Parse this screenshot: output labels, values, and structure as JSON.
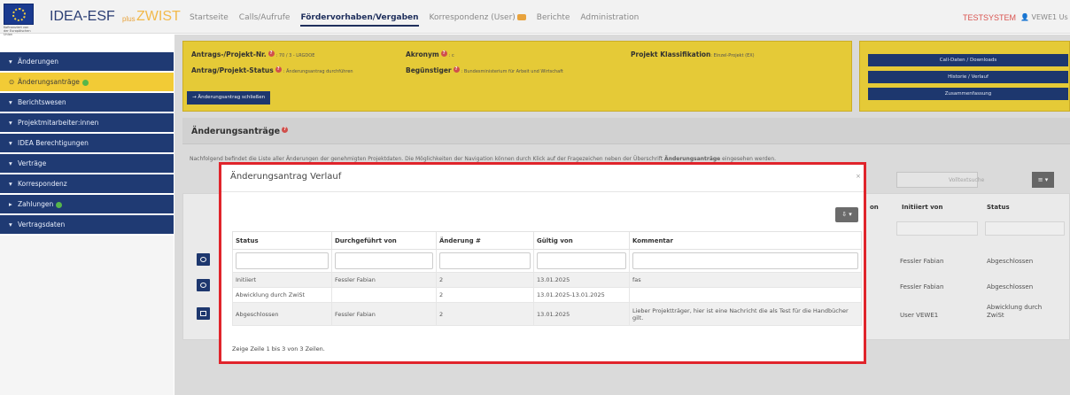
{
  "brand": {
    "eu_caption": "Kofinanziert von der Europäischen Union",
    "idea": "IDEA-ESF",
    "plus": "plus",
    "zwist": "ZWIST"
  },
  "nav": {
    "items": [
      "Startseite",
      "Calls/Aufrufe",
      "Fördervorhaben/Vergaben",
      "Korrespondenz (User)",
      "Berichte",
      "Administration"
    ],
    "testsystem": "TESTSYSTEM",
    "user": "VEWE1 Us"
  },
  "sidebar": {
    "items": [
      {
        "label": "Änderungen",
        "caret": "▾"
      },
      {
        "label": "Änderungsanträge",
        "caret": "⊙"
      },
      {
        "label": "Berichtswesen",
        "caret": "▾"
      },
      {
        "label": "Projektmitarbeiter:innen",
        "caret": "▾"
      },
      {
        "label": "IDEA Berechtigungen",
        "caret": "▾"
      },
      {
        "label": "Verträge",
        "caret": "▾"
      },
      {
        "label": "Korrespondenz",
        "caret": "▾"
      },
      {
        "label": "Zahlungen",
        "caret": "▸"
      },
      {
        "label": "Vertragsdaten",
        "caret": "▾"
      }
    ]
  },
  "project": {
    "antrag_label": "Antrags-/Projekt-Nr.",
    "antrag_value": ": 70 / 3 - LRGDOE",
    "akronym_label": "Akronym",
    "akronym_value": ": c",
    "klass_label": "Projekt Klassifikation",
    "klass_value": ": Einzel-Projekt (EX)",
    "status_label": "Antrag/Projekt-Status",
    "status_value": ": Änderungsantrag durchführen",
    "beg_label": "Begünstiger",
    "beg_value": ": Bundesministerium für Arbeit und Wirtschaft",
    "close_button": "→ Änderungsantrag schließen",
    "side_buttons": [
      "Call-Daten / Downloads",
      "Historie / Verlauf",
      "Zusammenfassung"
    ]
  },
  "section": {
    "title": "Änderungsanträge",
    "info_prefix": "Nachfolgend befindet die Liste aller Änderungen der genehmigten Projektdaten. Die Möglichkeiten der Navigation können durch Klick auf der Fragezeichen neben der Überschrift ",
    "info_bold": "Änderungsanträge",
    "info_suffix": " eingesehen werden.",
    "search_placeholder": "Volltextsuche",
    "menu_icon": "≡ ▾",
    "bg_headers": [
      "on",
      "Initiiert von",
      "Status"
    ],
    "bg_rows": [
      {
        "initiiert": "Fessler Fabian",
        "status": "Abgeschlossen"
      },
      {
        "initiiert": "Fessler Fabian",
        "status": "Abgeschlossen"
      },
      {
        "initiiert": "User VEWE1",
        "status": "Abwicklung durch ZwiSt"
      }
    ]
  },
  "modal": {
    "title": "Änderungsantrag Verlauf",
    "close": "×",
    "export_icon": "⇩ ▾",
    "columns": [
      "Status",
      "Durchgeführt von",
      "Änderung #",
      "Gültig von",
      "Kommentar"
    ],
    "rows": [
      {
        "status": "Initiiert",
        "by": "Fessler Fabian",
        "nr": "2",
        "valid": "13.01.2025",
        "comment": "fas"
      },
      {
        "status": "Abwicklung durch ZwiSt",
        "by": "",
        "nr": "2",
        "valid": "13.01.2025-13.01.2025",
        "comment": ""
      },
      {
        "status": "Abgeschlossen",
        "by": "Fessler Fabian",
        "nr": "2",
        "valid": "13.01.2025",
        "comment": "Lieber Projektträger, hier ist eine Nachricht die als Test für die Handbücher gilt."
      }
    ],
    "footer": "Zeige Zeile 1 bis 3 von 3 Zeilen."
  }
}
